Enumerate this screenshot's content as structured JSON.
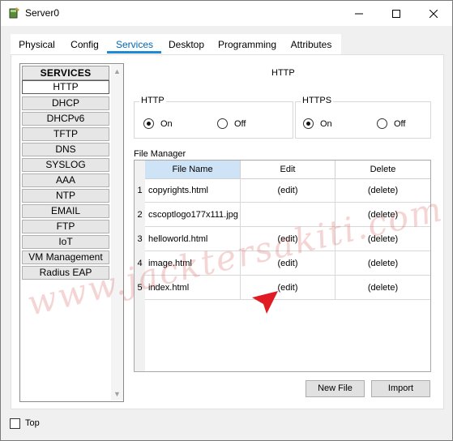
{
  "window": {
    "title": "Server0",
    "controls": {
      "minimize_icon": "minimize-icon",
      "maximize_icon": "maximize-icon",
      "close_icon": "close-icon"
    }
  },
  "tabs": [
    {
      "label": "Physical",
      "active": false
    },
    {
      "label": "Config",
      "active": false
    },
    {
      "label": "Services",
      "active": true
    },
    {
      "label": "Desktop",
      "active": false
    },
    {
      "label": "Programming",
      "active": false
    },
    {
      "label": "Attributes",
      "active": false
    }
  ],
  "sidebar": {
    "header": "SERVICES",
    "items": [
      {
        "label": "HTTP",
        "selected": true
      },
      {
        "label": "DHCP",
        "selected": false
      },
      {
        "label": "DHCPv6",
        "selected": false
      },
      {
        "label": "TFTP",
        "selected": false
      },
      {
        "label": "DNS",
        "selected": false
      },
      {
        "label": "SYSLOG",
        "selected": false
      },
      {
        "label": "AAA",
        "selected": false
      },
      {
        "label": "NTP",
        "selected": false
      },
      {
        "label": "EMAIL",
        "selected": false
      },
      {
        "label": "FTP",
        "selected": false
      },
      {
        "label": "IoT",
        "selected": false
      },
      {
        "label": "VM Management",
        "selected": false
      },
      {
        "label": "Radius EAP",
        "selected": false
      }
    ]
  },
  "main": {
    "title": "HTTP",
    "http": {
      "label": "HTTP",
      "on_label": "On",
      "off_label": "Off",
      "value": "On"
    },
    "https": {
      "label": "HTTPS",
      "on_label": "On",
      "off_label": "Off",
      "value": "On"
    },
    "file_manager": {
      "label": "File Manager",
      "columns": [
        "File Name",
        "Edit",
        "Delete"
      ],
      "rows": [
        {
          "num": "1",
          "name": "copyrights.html",
          "edit": "(edit)",
          "delete": "(delete)"
        },
        {
          "num": "2",
          "name": "cscoptlogo177x111.jpg",
          "edit": "",
          "delete": "(delete)"
        },
        {
          "num": "3",
          "name": "helloworld.html",
          "edit": "(edit)",
          "delete": "(delete)"
        },
        {
          "num": "4",
          "name": "image.html",
          "edit": "(edit)",
          "delete": "(delete)"
        },
        {
          "num": "5",
          "name": "index.html",
          "edit": "(edit)",
          "delete": "(delete)"
        }
      ]
    },
    "buttons": {
      "new_file": "New File",
      "import": "Import"
    }
  },
  "footer": {
    "top_label": "Top",
    "top_checked": false
  },
  "watermark": "www.jacktersakiti.com",
  "colors": {
    "accent": "#1e8ad6",
    "active_tab_text": "#0066b4",
    "header_selected": "#cfe3f7",
    "pointer": "#e01b24"
  }
}
